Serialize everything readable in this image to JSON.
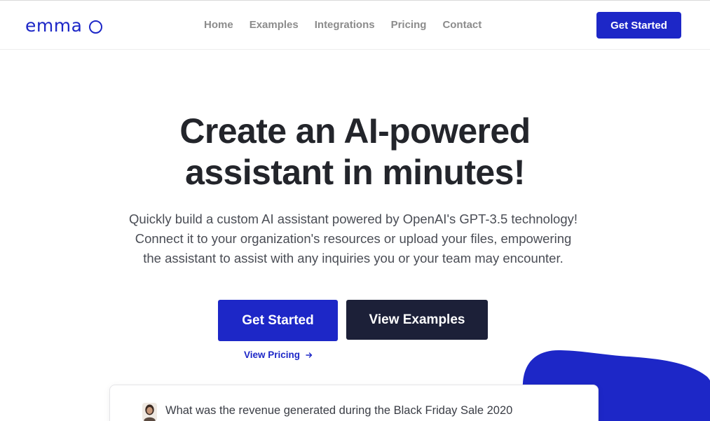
{
  "brand": {
    "name": "emma",
    "color": "#1d27c7"
  },
  "nav": {
    "items": [
      {
        "label": "Home"
      },
      {
        "label": "Examples"
      },
      {
        "label": "Integrations"
      },
      {
        "label": "Pricing"
      },
      {
        "label": "Contact"
      }
    ],
    "cta_label": "Get Started"
  },
  "hero": {
    "title_line1": "Create an AI-powered",
    "title_line2": "assistant in minutes!",
    "subtitle_line1": "Quickly build a custom AI assistant powered by OpenAI's GPT-3.5 technology!",
    "subtitle_line2": "Connect it to your organization's resources or upload your files, empowering",
    "subtitle_line3": "the assistant to assist with any inquiries you or your team may encounter.",
    "primary_cta": "Get Started",
    "secondary_cta": "View Examples",
    "pricing_link": "View Pricing",
    "pricing_icon": "arrow-right-icon"
  },
  "chat_preview": {
    "avatar_icon": "user-avatar",
    "question": "What was the revenue generated during the Black Friday Sale 2020"
  },
  "colors": {
    "primary": "#1d27c7",
    "dark": "#1c2038",
    "heading": "#23252b",
    "nav_text": "#8c8c8c"
  }
}
